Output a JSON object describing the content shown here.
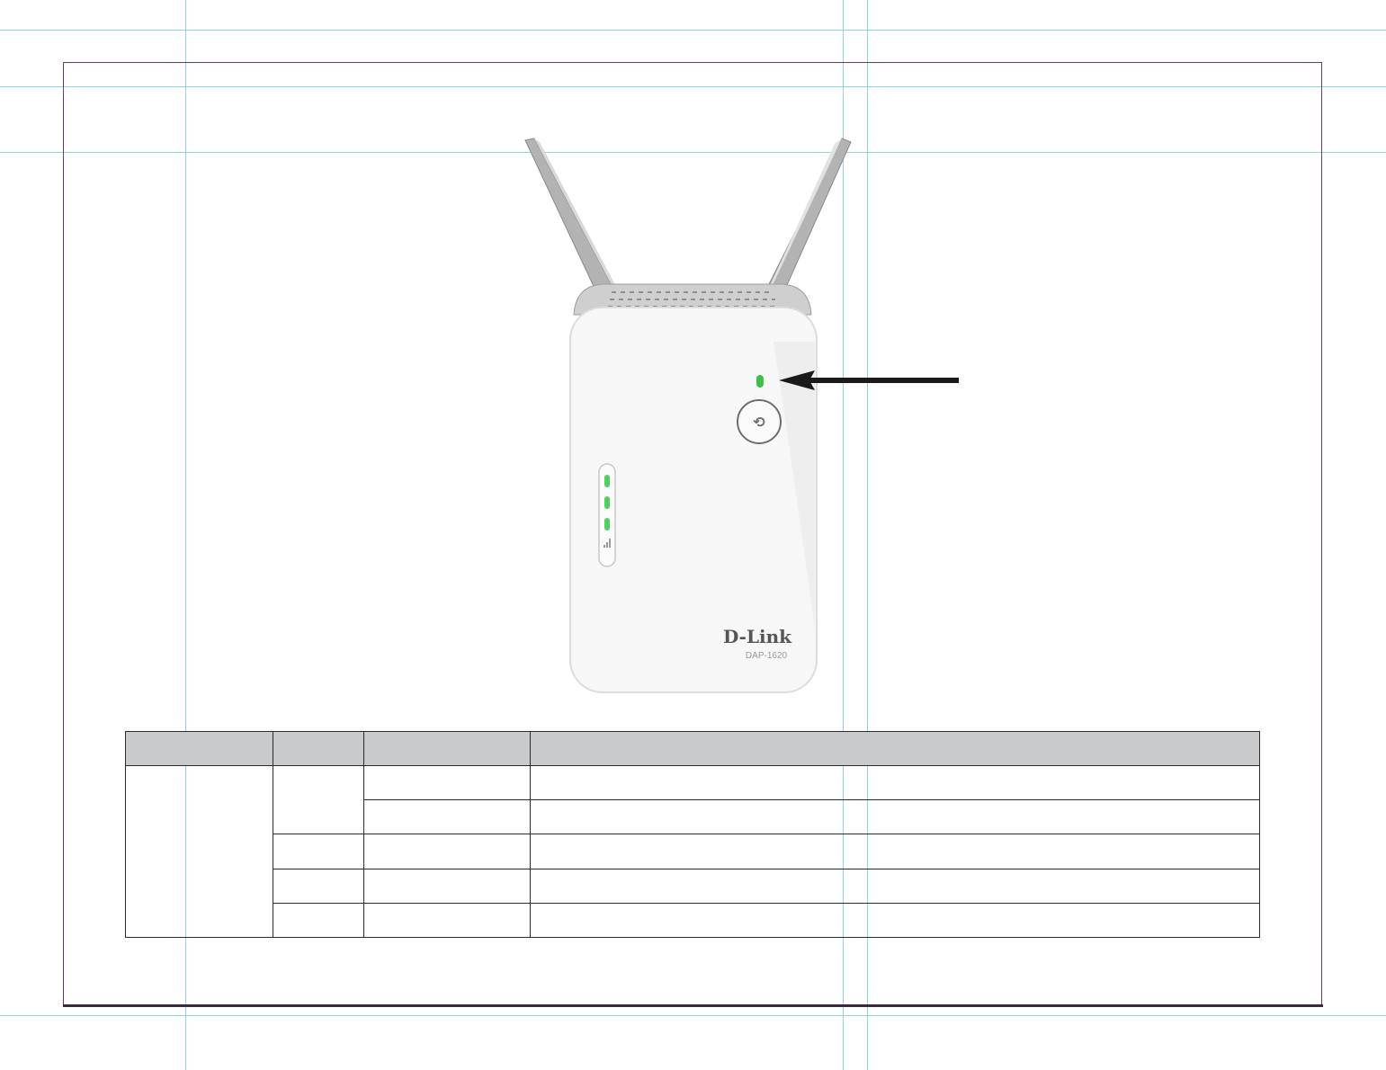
{
  "device": {
    "brand_logo": "D-Link",
    "model_label": "DAP-1620",
    "status_led_color": "#3cc24a",
    "signal_led_color": "#4dd15a",
    "body_color": "#f7f7f7",
    "antenna_color": "#a8a8a8",
    "button_icon": "wps-icon"
  },
  "table": {
    "header_bg": "#c9cacc",
    "headers": [
      "",
      "",
      "",
      ""
    ],
    "rows": [
      [
        "",
        "",
        "",
        ""
      ],
      [
        "",
        "",
        "",
        ""
      ],
      [
        "",
        "",
        "",
        ""
      ],
      [
        "",
        "",
        "",
        ""
      ],
      [
        "",
        "",
        "",
        ""
      ]
    ]
  }
}
